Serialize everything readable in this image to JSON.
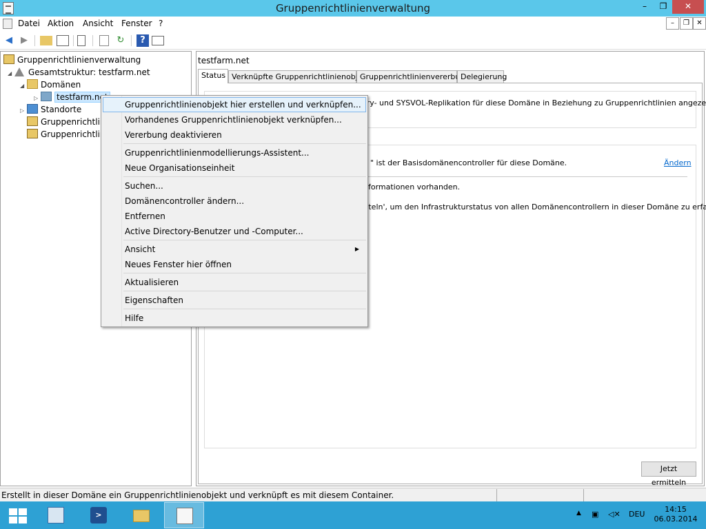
{
  "window": {
    "title": "Gruppenrichtlinienverwaltung",
    "minimize": "–",
    "maximize": "❐",
    "close": "✕"
  },
  "menubar": {
    "items": [
      "Datei",
      "Aktion",
      "Ansicht",
      "Fenster",
      "?"
    ]
  },
  "mdi_controls": [
    "–",
    "❐",
    "✕"
  ],
  "toolbar": {
    "icons": [
      "back-arrow-icon",
      "forward-arrow-icon",
      "up-folder-icon",
      "show-hide-console-tree-icon",
      "properties-icon",
      "export-list-icon",
      "refresh-icon",
      "help-icon",
      "show-action-pane-icon"
    ]
  },
  "tree": {
    "root": "Gruppenrichtlinienverwaltung",
    "forest": "Gesamtstruktur: testfarm.net",
    "domains": "Domänen",
    "domain": "testfarm.net",
    "sites": "Standorte",
    "gp_modeling": "Gruppenrichtlin",
    "gp_results": "Gruppenrichtlin"
  },
  "right": {
    "header": "testfarm.net",
    "tabs": [
      "Status",
      "Verknüpfte Gruppenrichtlinienobjekte",
      "Gruppenrichtlinienvererbung",
      "Delegierung"
    ],
    "line1": "ory- und SYSVOL-Replikation für diese Domäne in Beziehung zu Gruppenrichtlinien angezeigt.",
    "line2": "\" ist der Basisdomänencontroller für diese Domäne.",
    "change_link": "Ändern",
    "line3": "nformationen vorhanden.",
    "line4": "itteln', um den Infrastrukturstatus von allen Domänencontrollern in dieser Domäne zu erfassen.",
    "detect_button": "Jetzt ermitteln"
  },
  "context_menu": {
    "items": [
      "Gruppenrichtlinienobjekt hier erstellen und verknüpfen...",
      "Vorhandenes Gruppenrichtlinienobjekt verknüpfen...",
      "Vererbung deaktivieren",
      "Gruppenrichtlinienmodellierungs-Assistent...",
      "Neue Organisationseinheit",
      "Suchen...",
      "Domänencontroller ändern...",
      "Entfernen",
      "Active Directory-Benutzer und -Computer...",
      "Ansicht",
      "Neues Fenster hier öffnen",
      "Aktualisieren",
      "Eigenschaften",
      "Hilfe"
    ],
    "submenu_arrow": "▶"
  },
  "statusbar": {
    "text": "Erstellt in dieser Domäne ein Gruppenrichtlinienobjekt und verknüpft es mit diesem Container."
  },
  "taskbar": {
    "apps": [
      "server-manager-icon",
      "powershell-icon",
      "file-explorer-icon",
      "group-policy-management-icon"
    ],
    "language": "DEU",
    "time": "14:15",
    "date": "06.03.2014",
    "tray_icons": [
      "show-hidden-icons-icon",
      "network-icon",
      "speaker-muted-icon"
    ]
  },
  "colors": {
    "titlebar": "#5ac7ea",
    "taskbar": "#2ea1d4",
    "link": "#0066cc",
    "selection": "#cce8ff"
  }
}
